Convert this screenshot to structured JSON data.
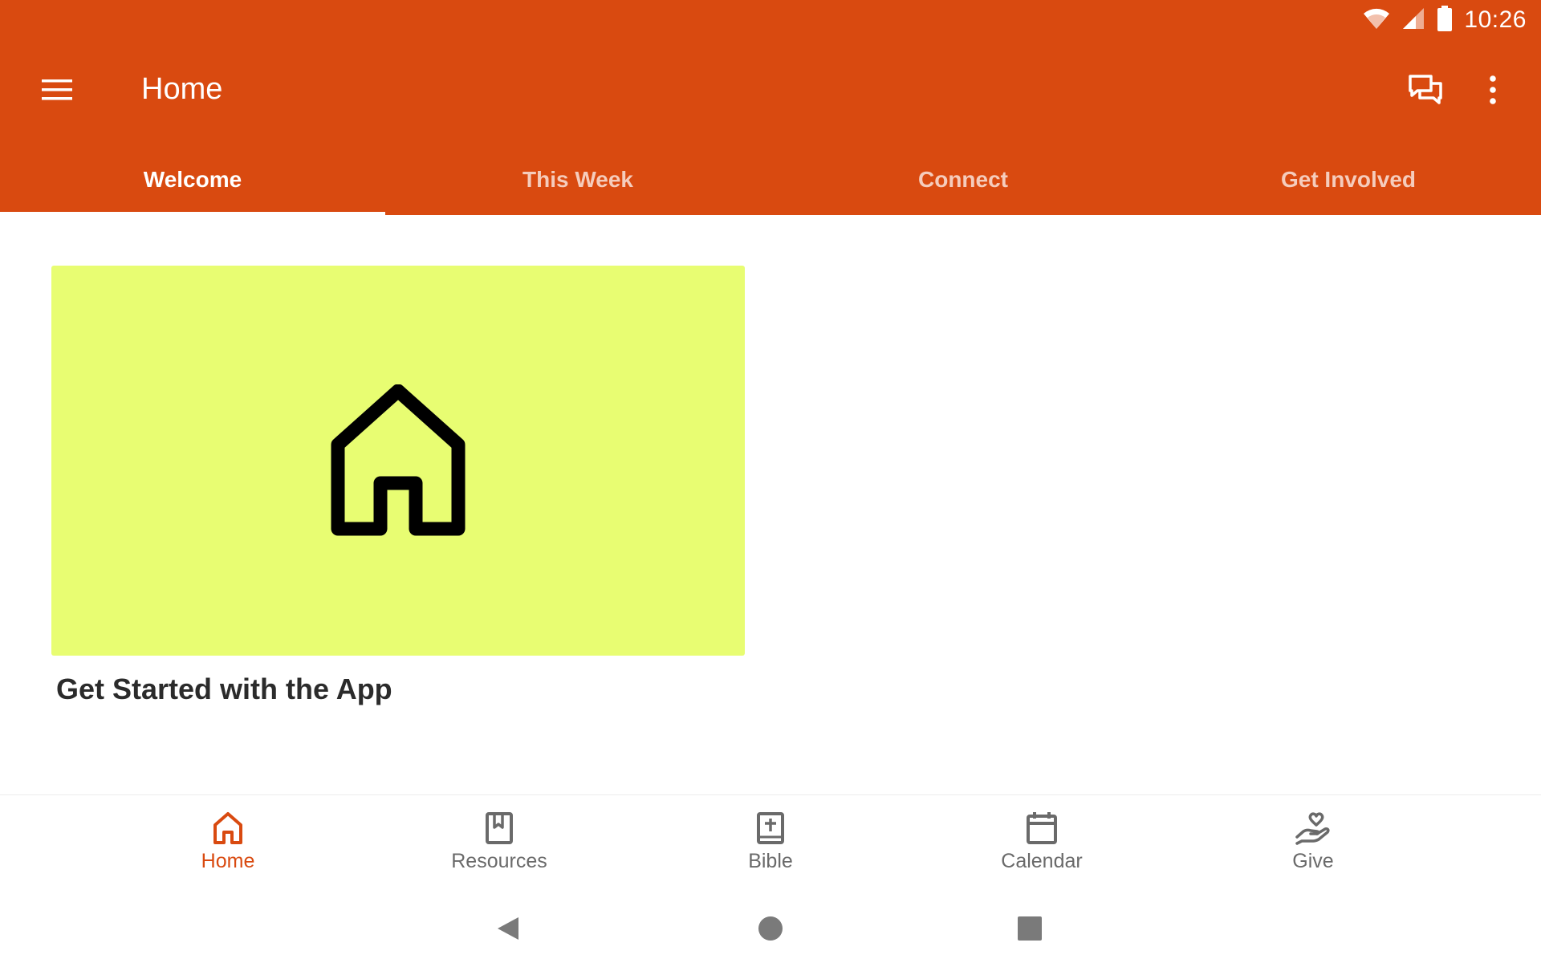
{
  "status_bar": {
    "time": "10:26",
    "icons": [
      "wifi-icon",
      "cellular-signal-icon",
      "battery-icon"
    ]
  },
  "toolbar": {
    "title": "Home",
    "menu_icon": "hamburger-menu-icon",
    "actions": [
      "chat-icon",
      "more-vertical-icon"
    ]
  },
  "tabs": [
    {
      "label": "Welcome",
      "active": true
    },
    {
      "label": "This Week",
      "active": false
    },
    {
      "label": "Connect",
      "active": false
    },
    {
      "label": "Get Involved",
      "active": false
    }
  ],
  "content": {
    "card": {
      "icon": "home-outline-icon",
      "background": "#e8fd72",
      "title": "Get Started with the App"
    }
  },
  "bottom_nav": {
    "items": [
      {
        "label": "Home",
        "icon": "home-icon",
        "active": true
      },
      {
        "label": "Resources",
        "icon": "bookmark-book-icon",
        "active": false
      },
      {
        "label": "Bible",
        "icon": "bible-icon",
        "active": false
      },
      {
        "label": "Calendar",
        "icon": "calendar-icon",
        "active": false
      },
      {
        "label": "Give",
        "icon": "giving-hand-heart-icon",
        "active": false
      }
    ]
  },
  "system_nav": [
    "back-icon",
    "home-circle-icon",
    "recents-icon"
  ],
  "colors": {
    "primary": "#d94a10",
    "card_background": "#e8fd72",
    "nav_inactive": "#6a6a6a",
    "text_dark": "#2b2b2b"
  }
}
